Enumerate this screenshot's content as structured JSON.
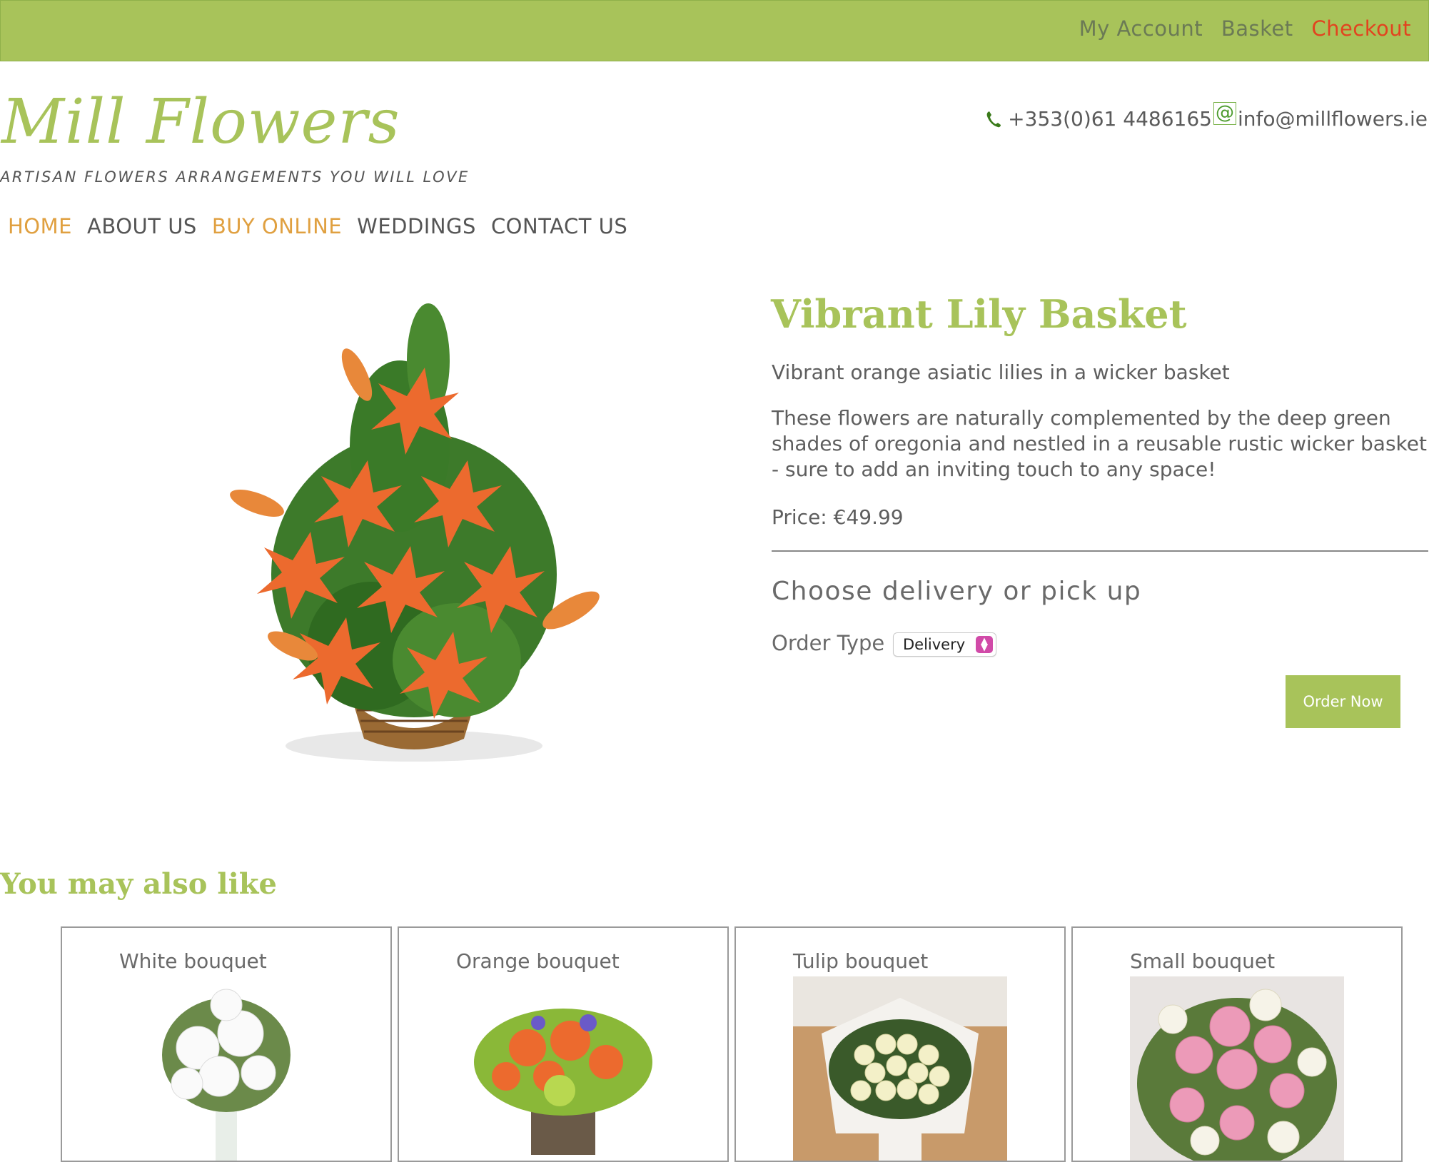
{
  "topbar": {
    "links": [
      {
        "label": "My Account",
        "name": "my-account-link"
      },
      {
        "label": "Basket",
        "name": "basket-link"
      },
      {
        "label": "Checkout",
        "name": "checkout-link"
      }
    ]
  },
  "brand": {
    "logo": "Mill Flowers",
    "tagline": "ARTISAN FLOWERS ARRANGEMENTS YOU WILL LOVE"
  },
  "contact": {
    "phone": "+353(0)61 4486165",
    "phone_icon": "phone-icon",
    "email": "info@millflowers.ie",
    "email_icon": "at-icon"
  },
  "nav": {
    "items": [
      {
        "label": "HOME",
        "active": true
      },
      {
        "label": "ABOUT US",
        "active": false
      },
      {
        "label": "BUY ONLINE",
        "active": true
      },
      {
        "label": "WEDDINGS",
        "active": false
      },
      {
        "label": "CONTACT US",
        "active": false
      }
    ]
  },
  "product": {
    "title": "Vibrant Lily Basket",
    "short_description": "Vibrant orange asiatic lilies in a wicker basket",
    "long_description": "These flowers are naturally complemented by the deep green shades of oregonia and nestled in a reusable rustic wicker basket - sure to add an inviting touch to any space!",
    "price": "Price: €49.99",
    "choose_heading": "Choose delivery or pick up",
    "order_type_label": "Order Type",
    "order_type_value": "Delivery",
    "order_button": "Order Now"
  },
  "related": {
    "heading": "You may also like",
    "items": [
      {
        "name": "White bouquet"
      },
      {
        "name": "Orange bouquet"
      },
      {
        "name": "Tulip bouquet"
      },
      {
        "name": "Small bouquet"
      }
    ]
  },
  "colors": {
    "accent_green": "#a8c35a",
    "nav_active": "#e0a040",
    "checkout_red": "#e2431f"
  }
}
